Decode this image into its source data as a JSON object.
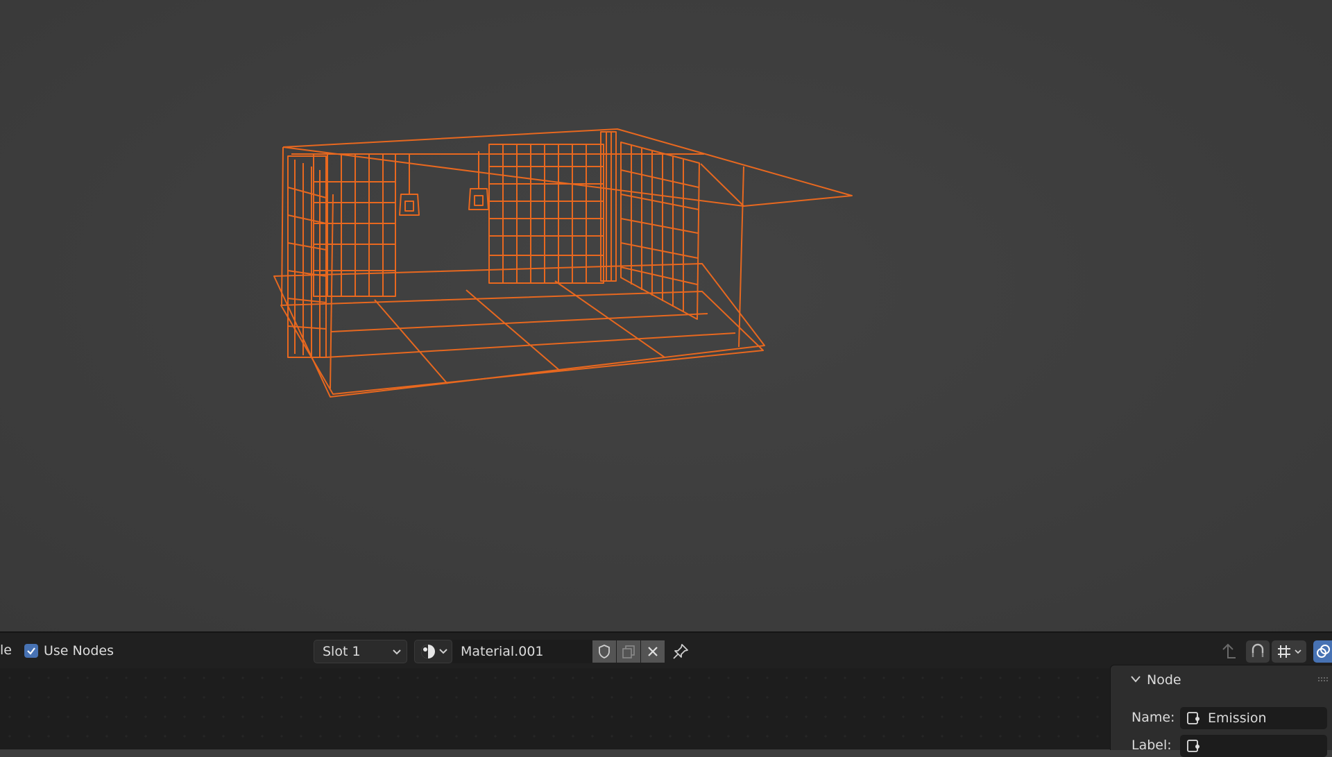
{
  "header": {
    "mode_fragment": "le",
    "use_nodes": {
      "label": "Use Nodes",
      "checked": true
    },
    "slot": {
      "label": "Slot 1"
    },
    "material": {
      "name": "Material.001"
    }
  },
  "sidebar": {
    "panel_title": "Node",
    "name_label": "Name:",
    "name_value": "Emission",
    "label_label": "Label:",
    "label_value": ""
  },
  "icons": {
    "viewport": "3d-wireframe-room",
    "material_type": "sphere-icon",
    "fake_user": "shield-icon",
    "duplicate": "duplicate-icon",
    "unlink": "close-icon",
    "pin": "pin-icon",
    "parent": "arrow-up-icon",
    "snap": "magnet-icon",
    "snap_mode": "grid-snap-icon",
    "overlay": "overlay-icon"
  },
  "colors": {
    "accent": "#4772b3",
    "wireframe": "#e8681f",
    "viewport_bg": "#3d3d3d",
    "header_bg": "#202020"
  }
}
